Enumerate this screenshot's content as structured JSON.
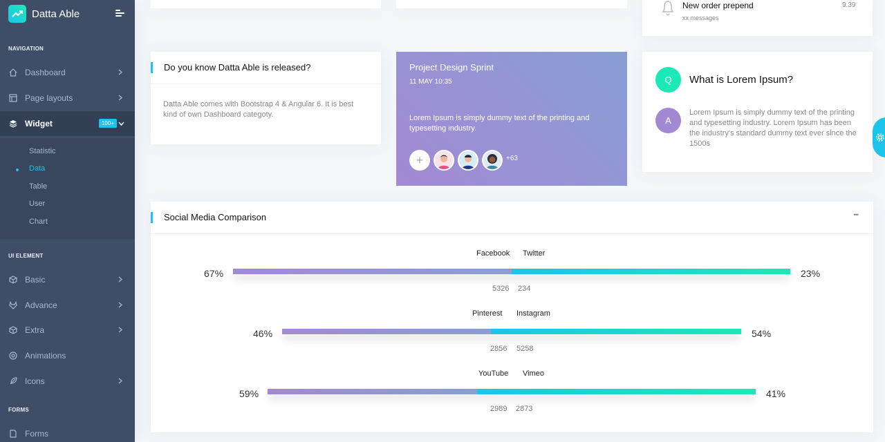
{
  "brand": {
    "name": "Datta Able"
  },
  "nav": {
    "caption_navigation": "NAVIGATION",
    "caption_ui": "UI ELEMENT",
    "caption_forms": "FORMS",
    "dashboard": "Dashboard",
    "page_layouts": "Page layouts",
    "widget": "Widget",
    "widget_badge": "100+",
    "widget_sub": [
      "Statistic",
      "Data",
      "Table",
      "User",
      "Chart"
    ],
    "basic": "Basic",
    "advance": "Advance",
    "extra": "Extra",
    "animations": "Animations",
    "icons": "Icons",
    "forms": "Forms"
  },
  "notification": {
    "title": "New order prepend",
    "subtitle": "xx messages",
    "time": "9.39"
  },
  "info_card": {
    "title": "Do you know Datta Able is released?",
    "body": "Datta Able comes with Bootstrap 4 & Angular 6. It is best kind of own Dashboard categoty."
  },
  "sprint": {
    "title": "Project Design Sprint",
    "date": "11 MAY 10:35",
    "body": "Lorem Ipsum is simply dummy text of the printing and typesetting industry.",
    "add": "+",
    "more": "+63"
  },
  "qa": {
    "q_label": "Q",
    "question": "What is Lorem Ipsum?",
    "a_label": "A",
    "answer": "Lorem Ipsum is simply dummy text of the printing and typesetting industry. Lorem Ipsum has been the industry's standard dummy text ever since the 1500s"
  },
  "social": {
    "title": "Social Media Comparison",
    "menu": "•••",
    "rows": [
      {
        "left_name": "Facebook",
        "right_name": "Twitter",
        "left_pct": "67%",
        "right_pct": "23%",
        "left_count": "5326",
        "right_count": "234",
        "split": 0.5
      },
      {
        "left_name": "Pinterest",
        "right_name": "Instagram",
        "left_pct": "46%",
        "right_pct": "54%",
        "left_count": "2856",
        "right_count": "5258",
        "split": 0.46
      },
      {
        "left_name": "YouTube",
        "right_name": "Vimeo",
        "left_pct": "59%",
        "right_pct": "41%",
        "left_count": "2989",
        "right_count": "2873",
        "split": 0.43
      }
    ]
  },
  "colors": {
    "sidebar": "#3f4d67",
    "accent": "#1dc4e9",
    "green": "#1de9b6",
    "purple": "#a389d4"
  }
}
